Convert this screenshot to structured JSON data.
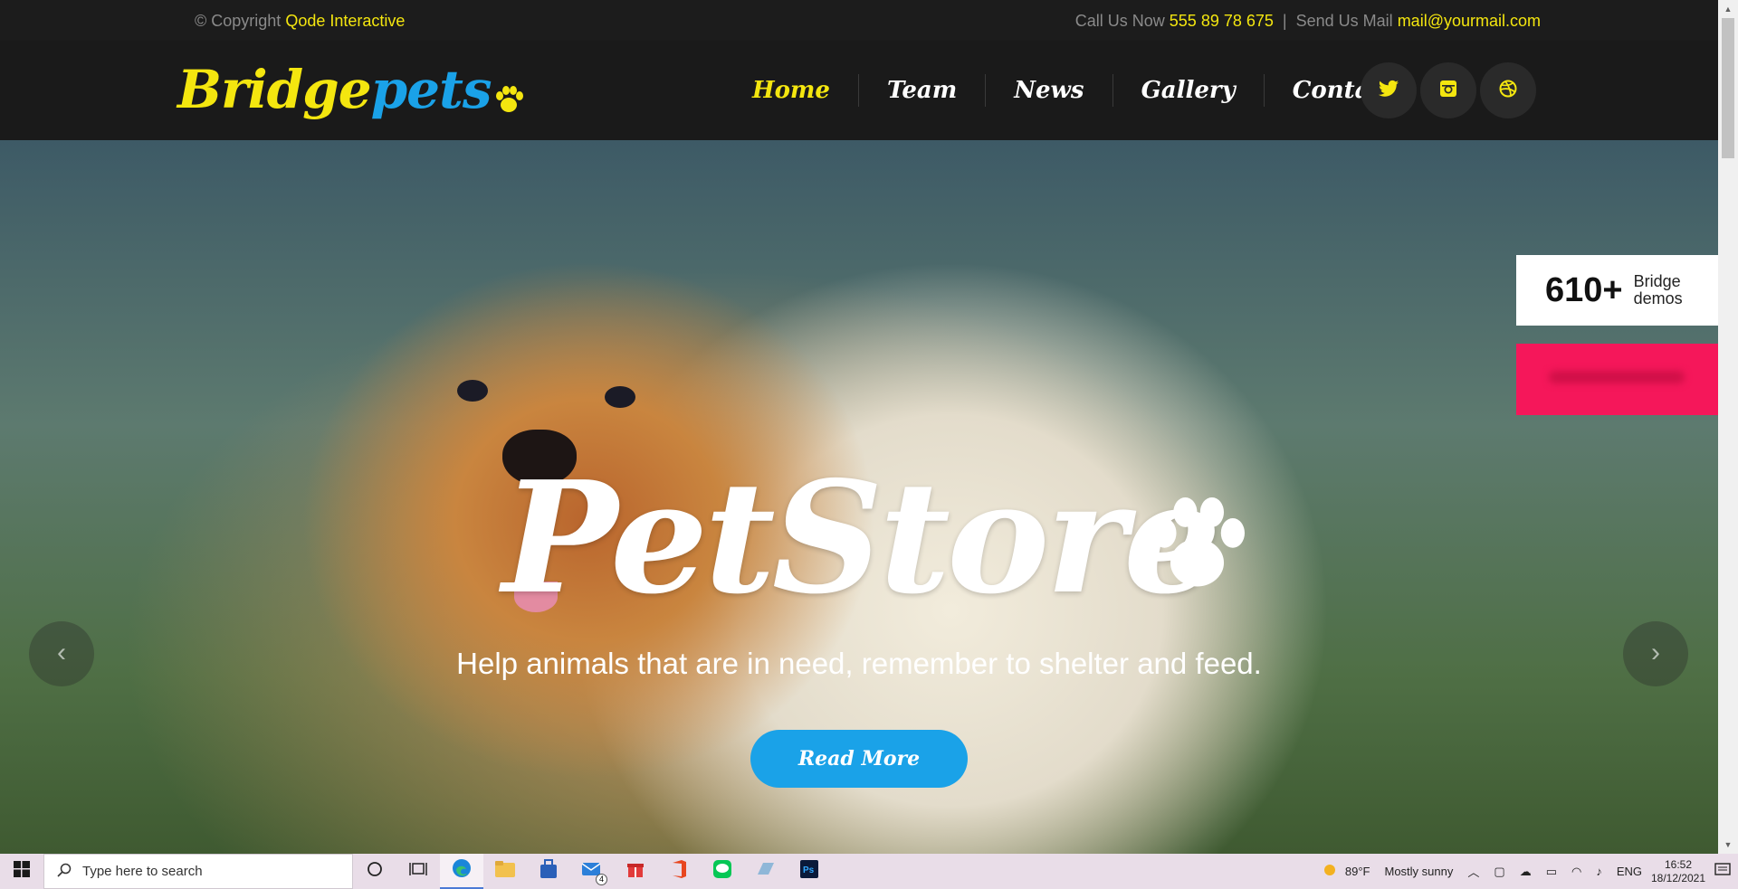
{
  "topbar": {
    "copyright_prefix": "© Copyright",
    "company": "Qode Interactive",
    "call_label": "Call Us Now",
    "phone": "555 89 78 675",
    "divider": "|",
    "mail_label": "Send Us Mail",
    "email": "mail@yourmail.com"
  },
  "logo": {
    "part1": "Bridge",
    "part2": "pets"
  },
  "nav": {
    "items": [
      {
        "label": "Home",
        "active": true
      },
      {
        "label": "Team"
      },
      {
        "label": "News"
      },
      {
        "label": "Gallery"
      },
      {
        "label": "Contact"
      }
    ]
  },
  "socials": [
    "twitter-icon",
    "instagram-icon",
    "dribbble-icon"
  ],
  "hero": {
    "title": "PetStore",
    "subtitle": "Help animals that are in need, remember to shelter and feed.",
    "button": "Read More",
    "prev": "‹",
    "next": "›"
  },
  "demos": {
    "count": "610+",
    "line1": "Bridge",
    "line2": "demos"
  },
  "taskbar": {
    "search_placeholder": "Type here to search",
    "mail_badge": "4",
    "temperature": "89°F",
    "weather": "Mostly sunny",
    "language": "ENG",
    "time": "16:52",
    "date": "18/12/2021"
  },
  "colors": {
    "accent_yellow": "#f4e60f",
    "accent_blue": "#1aa2e8",
    "promo_red": "#f5175a"
  }
}
